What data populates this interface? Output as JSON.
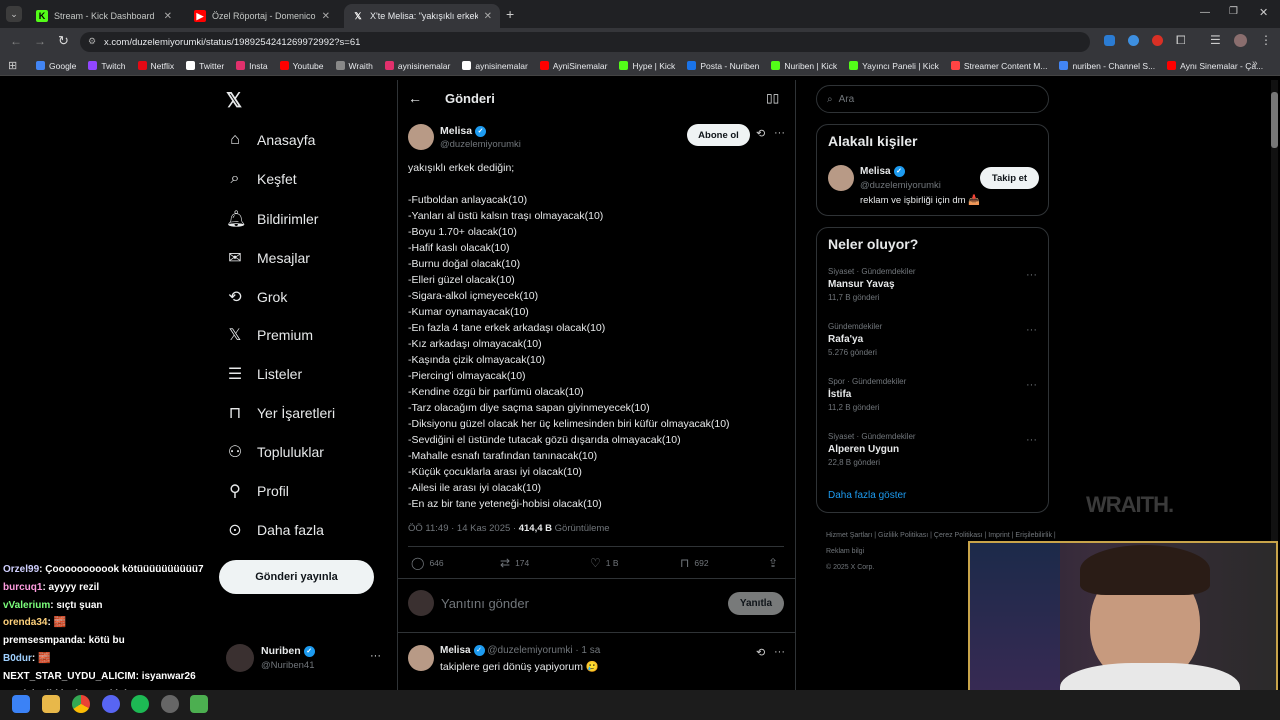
{
  "browser": {
    "tabs": [
      {
        "title": "Stream - Kick Dashboard",
        "icon": "kick",
        "color": "#53fc18"
      },
      {
        "title": "Özel Röportaj - Domenico Tede",
        "icon": "youtube",
        "color": "#ff0000"
      },
      {
        "title": "X'te Melisa: \"yakışıklı erkek dedi",
        "icon": "x",
        "color": "#ffffff"
      }
    ],
    "url": "x.com/duzelemiyorumki/status/1989254241269972992?s=61",
    "bookmarks": [
      "Google",
      "Twitch",
      "Netflix",
      "Twitter",
      "Insta",
      "Youtube",
      "Wraith",
      "aynisinemalar",
      "aynisinemalar",
      "AyniSinemalar",
      "Hype | Kick",
      "Posta - Nuriben",
      "Nuriben | Kick",
      "Yayıncı Paneli | Kick",
      "Streamer Content M...",
      "nuriben - Channel S...",
      "Aynı Sinemalar - Ça..."
    ]
  },
  "nav": {
    "items": [
      "Anasayfa",
      "Keşfet",
      "Bildirimler",
      "Mesajlar",
      "Grok",
      "Premium",
      "Listeler",
      "Yer İşaretleri",
      "Topluluklar",
      "Profil",
      "Daha fazla"
    ],
    "icons": [
      "home-icon",
      "search-icon",
      "bell-icon",
      "mail-icon",
      "grok-icon",
      "x-icon",
      "list-icon",
      "bookmark-icon",
      "community-icon",
      "person-icon",
      "more-icon"
    ],
    "post_button": "Gönderi yayınla",
    "account": {
      "name": "Nuriben",
      "handle": "@Nuriben41"
    }
  },
  "header": {
    "title": "Gönderi"
  },
  "tweet": {
    "author": "Melisa",
    "handle": "@duzelemiyorumki",
    "subscribe": "Abone ol",
    "intro": "yakışıklı erkek dediğin;",
    "lines": [
      "-Futboldan anlayacak(10)",
      "-Yanları al üstü kalsın traşı olmayacak(10)",
      "-Boyu 1.70+ olacak(10)",
      "-Hafif kaslı olacak(10)",
      "-Burnu doğal olacak(10)",
      "-Elleri güzel olacak(10)",
      "-Sigara-alkol içmeyecek(10)",
      "-Kumar oynamayacak(10)",
      "-En fazla 4 tane erkek arkadaşı olacak(10)",
      "-Kız arkadaşı olmayacak(10)",
      "-Kaşında çizik olmayacak(10)",
      "-Piercing'i olmayacak(10)",
      "-Kendine özgü bir parfümü olacak(10)",
      "-Tarz olacağım diye saçma sapan giyinmeyecek(10)",
      "-Diksiyonu güzel olacak her üç kelimesinden biri küfür olmayacak(10)",
      "-Sevdiğini el üstünde tutacak gözü dışarıda olmayacak(10)",
      "-Mahalle esnafı tarafından tanınacak(10)",
      "-Küçük çocuklarla arası iyi olacak(10)",
      "-Ailesi ile arası iyi olacak(10)",
      "-En az bir tane yeteneği-hobisi olacak(10)"
    ],
    "time": "ÖÖ 11:49 · 14 Kas 2025 · ",
    "views": "414,4 B",
    "views_label": " Görüntüleme",
    "replies": "646",
    "retweets": "174",
    "likes": "1 B",
    "bookmarks": "692",
    "reply_placeholder": "Yanıtını gönder",
    "reply_button": "Yanıtla"
  },
  "reply": {
    "author": "Melisa",
    "handle": "@duzelemiyorumki · 1 sa",
    "text": "takiplere geri dönüş yapiyorum 🥲"
  },
  "search": {
    "placeholder": "Ara"
  },
  "related": {
    "title": "Alakalı kişiler",
    "name": "Melisa",
    "handle": "@duzelemiyorumki",
    "follow": "Takip et",
    "bio": "reklam ve işbirliği için dm 📥"
  },
  "trends": {
    "title": "Neler oluyor?",
    "items": [
      {
        "cat": "Siyaset · Gündemdekiler",
        "name": "Mansur Yavaş",
        "count": "11,7 B gönderi"
      },
      {
        "cat": "Gündemdekiler",
        "name": "Rafa'ya",
        "count": "5.276 gönderi"
      },
      {
        "cat": "Spor · Gündemdekiler",
        "name": "İstifa",
        "count": "11,2 B gönderi"
      },
      {
        "cat": "Siyaset · Gündemdekiler",
        "name": "Alperen Uygun",
        "count": "22,8 B gönderi"
      }
    ],
    "more": "Daha fazla göster"
  },
  "footer": {
    "links": [
      "Hizmet Şartları",
      "Gizlilik Politikası",
      "Çerez Politikası",
      "Imprint",
      "Erişilebilirlik",
      "Reklam bilgi"
    ],
    "copy": "© 2025 X Corp."
  },
  "watermark": "WRAITH.",
  "chat": [
    {
      "user": "Orzel99",
      "color": "#d0d0ff",
      "msg": ": Çooooooooook kötüüüüüüüüüü7"
    },
    {
      "user": "burcuq1",
      "color": "#ff9de0",
      "msg": ": ayyyy rezil"
    },
    {
      "user": "vValerium",
      "color": "#7cff7c",
      "msg": ": sıçtı şuan"
    },
    {
      "user": "orenda34",
      "color": "#ffd27c",
      "msg": ": 🧱"
    },
    {
      "user": "premsesmpanda",
      "color": "#ffffff",
      "msg": ": kötü bu"
    },
    {
      "user": "B0dur",
      "color": "#9fd0ff",
      "msg": ": 🧱"
    },
    {
      "user": "NEXT_STAR_UYDU_ALICIM",
      "color": "#ffffff",
      "msg": ": isyanwar26"
    },
    {
      "user": "",
      "color": "#ffffff",
      "msg": ": melek gibi kadının sakinimm"
    }
  ]
}
